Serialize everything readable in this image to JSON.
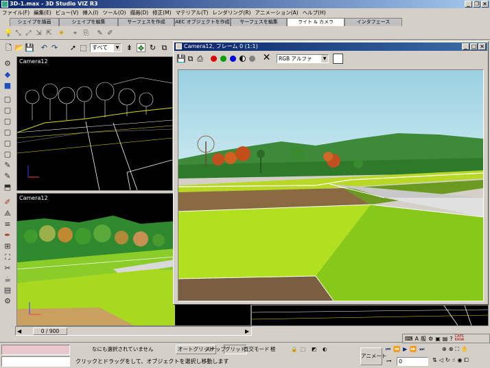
{
  "window": {
    "title": "3D-1.max - 3D Studio VIZ R3",
    "minimize": "_",
    "restore": "❐",
    "close": "×"
  },
  "menu": {
    "items": [
      "ファイル(F)",
      "編集(E)",
      "ビュー(V)",
      "挿入(I)",
      "ツール(O)",
      "描画(D)",
      "修正(M)",
      "マテリアル(T)",
      "レンダリング(R)",
      "アニメーション(A)",
      "ヘルプ(H)"
    ]
  },
  "command_tabs": {
    "items": [
      "シェイプを描画",
      "シェイプを編集",
      "サーフェスを作成",
      "AEC オブジェクトを作成",
      "サーフェスを編集",
      "ライト & カメラ",
      "インタフェース"
    ],
    "active_index": 5
  },
  "main_toolbar": {
    "selection_filter": "すべて"
  },
  "viewports": {
    "top_left_label": "Camera12",
    "bottom_left_label": "Camera12"
  },
  "render_window": {
    "title": "Camera12, フレーム 0 (1:1)",
    "channel": "RGB アルファ",
    "colors": {
      "red": "#e00000",
      "green": "#00a000",
      "blue": "#0000e0"
    }
  },
  "time_slider": {
    "value": "0 / 900"
  },
  "status": {
    "selection": "なにも選択されていません",
    "prompt": "クリックとドラッグをして、オブジェクトを選択し移動します",
    "grid_snap": "オートグリッド",
    "snap": "スナップ",
    "grid": "グリッド",
    "orth": "直交モード",
    "degree": "極",
    "animate": "アニメート",
    "frame": "0",
    "caps": "CAPS",
    "kana": "KANA"
  },
  "ime": {
    "mode": "A",
    "kana": "般"
  }
}
